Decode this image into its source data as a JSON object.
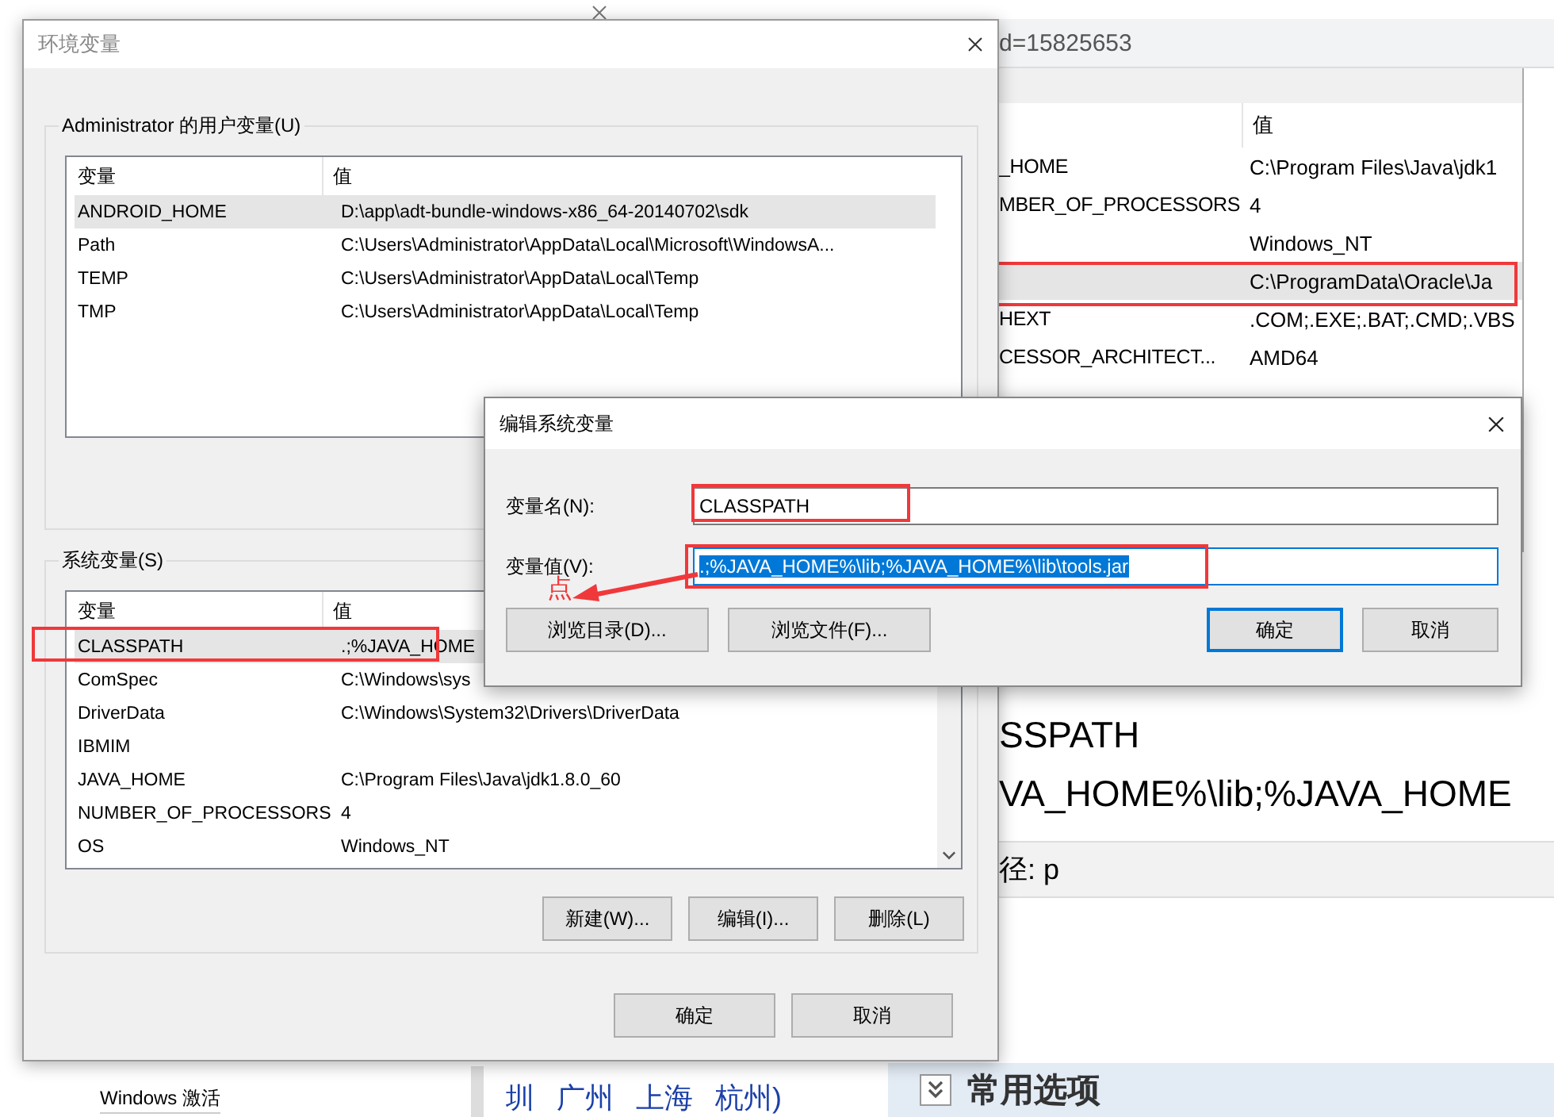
{
  "browser": {
    "address": "d=15825653"
  },
  "back_dialog": {
    "column": "值",
    "rows": [
      {
        "name": "_HOME",
        "value": "C:\\Program Files\\Java\\jdk1",
        "selected": false,
        "annotated": false
      },
      {
        "name": "MBER_OF_PROCESSORS",
        "value": "4",
        "selected": false,
        "annotated": false
      },
      {
        "name": "",
        "value": "Windows_NT",
        "selected": false,
        "annotated": false
      },
      {
        "name": "",
        "value": "C:\\ProgramData\\Oracle\\Ja",
        "selected": true,
        "annotated": true
      },
      {
        "name": "HEXT",
        "value": ".COM;.EXE;.BAT;.CMD;.VBS",
        "selected": false,
        "annotated": false
      },
      {
        "name": "CESSOR_ARCHITECT...",
        "value": "AMD64",
        "selected": false,
        "annotated": false
      }
    ]
  },
  "page": {
    "heading": "SSPATH",
    "line": "VA_HOME%\\lib;%JAVA_HOME",
    "path_label": "径: p",
    "section": "常用选项",
    "links": [
      "圳",
      "广州",
      "上海",
      "杭州)"
    ],
    "footer": "Windows 激活"
  },
  "main_dialog": {
    "title": "环境变量",
    "user_group": {
      "label": "Administrator 的用户变量(U)",
      "columns": [
        "变量",
        "值"
      ],
      "rows": [
        {
          "name": "ANDROID_HOME",
          "value": "D:\\app\\adt-bundle-windows-x86_64-20140702\\sdk",
          "selected": true
        },
        {
          "name": "Path",
          "value": "C:\\Users\\Administrator\\AppData\\Local\\Microsoft\\WindowsA...",
          "selected": false
        },
        {
          "name": "TEMP",
          "value": "C:\\Users\\Administrator\\AppData\\Local\\Temp",
          "selected": false
        },
        {
          "name": "TMP",
          "value": "C:\\Users\\Administrator\\AppData\\Local\\Temp",
          "selected": false
        }
      ]
    },
    "system_group": {
      "label": "系统变量(S)",
      "columns": [
        "变量",
        "值"
      ],
      "rows": [
        {
          "name": "CLASSPATH",
          "value": ".;%JAVA_HOME",
          "selected": true,
          "annotated": true
        },
        {
          "name": "ComSpec",
          "value": "C:\\Windows\\sys",
          "selected": false,
          "annotated": false
        },
        {
          "name": "DriverData",
          "value": "C:\\Windows\\System32\\Drivers\\DriverData",
          "selected": false,
          "annotated": false
        },
        {
          "name": "IBMIM",
          "value": "",
          "selected": false,
          "annotated": false
        },
        {
          "name": "JAVA_HOME",
          "value": "C:\\Program Files\\Java\\jdk1.8.0_60",
          "selected": false,
          "annotated": false
        },
        {
          "name": "NUMBER_OF_PROCESSORS",
          "value": "4",
          "selected": false,
          "annotated": false
        },
        {
          "name": "OS",
          "value": "Windows_NT",
          "selected": false,
          "annotated": false
        }
      ],
      "buttons": [
        "新建(W)...",
        "编辑(I)...",
        "删除(L)"
      ]
    },
    "buttons": [
      {
        "label": "确定",
        "default": false
      },
      {
        "label": "取消",
        "default": false
      }
    ]
  },
  "edit_dialog": {
    "title": "编辑系统变量",
    "fields": [
      {
        "label": "变量名(N):",
        "value": "CLASSPATH",
        "text_selected": false,
        "annotated": true
      },
      {
        "label": "变量值(V):",
        "value": ".;%JAVA_HOME%\\lib;%JAVA_HOME%\\lib\\tools.jar",
        "text_selected": true,
        "annotated": true
      }
    ],
    "browse_buttons": [
      "浏览目录(D)...",
      "浏览文件(F)..."
    ],
    "buttons": [
      {
        "label": "确定",
        "default": true
      },
      {
        "label": "取消",
        "default": false
      }
    ],
    "annotation": "点"
  }
}
